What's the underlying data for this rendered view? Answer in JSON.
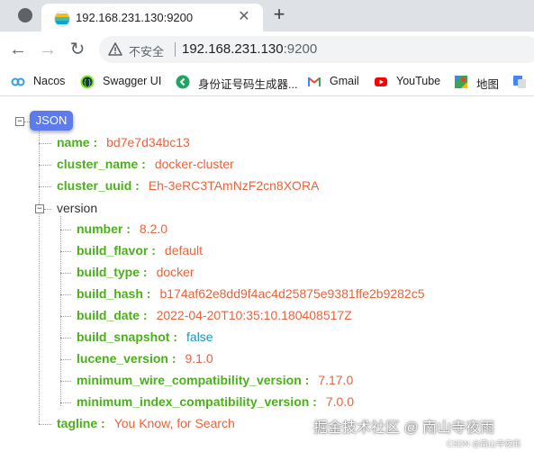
{
  "tab": {
    "title": "192.168.231.130:9200",
    "close": "✕",
    "new_tab": "+"
  },
  "toolbar": {
    "back": "←",
    "forward": "→",
    "reload": "↻",
    "security_label": "不安全",
    "url_host": "192.168.231.130",
    "url_port": ":9200"
  },
  "bookmarks": [
    {
      "label": "Nacos",
      "icon": "nacos-icon"
    },
    {
      "label": "Swagger UI",
      "icon": "swagger-icon"
    },
    {
      "label": "身份证号码生成器...",
      "icon": "id-generator-icon"
    },
    {
      "label": "Gmail",
      "icon": "gmail-icon"
    },
    {
      "label": "YouTube",
      "icon": "youtube-icon"
    },
    {
      "label": "地图",
      "icon": "maps-icon"
    }
  ],
  "json": {
    "root_label": "JSON",
    "toggle_collapse": "−",
    "fields": [
      {
        "key": "name",
        "value": "bd7e7d34bc13"
      },
      {
        "key": "cluster_name",
        "value": "docker-cluster"
      },
      {
        "key": "cluster_uuid",
        "value": "Eh-3eRC3TAmNzF2cn8XORA"
      }
    ],
    "version_key": "version",
    "version_fields": [
      {
        "key": "number",
        "value": "8.2.0",
        "type": "string"
      },
      {
        "key": "build_flavor",
        "value": "default",
        "type": "string"
      },
      {
        "key": "build_type",
        "value": "docker",
        "type": "string"
      },
      {
        "key": "build_hash",
        "value": "b174af62e8dd9f4ac4d25875e9381ffe2b9282c5",
        "type": "string"
      },
      {
        "key": "build_date",
        "value": "2022-04-20T10:35:10.180408517Z",
        "type": "string"
      },
      {
        "key": "build_snapshot",
        "value": "false",
        "type": "boolean"
      },
      {
        "key": "lucene_version",
        "value": "9.1.0",
        "type": "string"
      },
      {
        "key": "minimum_wire_compatibility_version",
        "value": "7.17.0",
        "type": "string"
      },
      {
        "key": "minimum_index_compatibility_version",
        "value": "7.0.0",
        "type": "string"
      }
    ],
    "tagline": {
      "key": "tagline",
      "value": "You Know, for Search"
    }
  },
  "watermark": {
    "main": "掘金技术社区 @ 南山寺夜雨",
    "sub": "CSDN @南山寺夜雨"
  },
  "colors": {
    "key": "#4caf1c",
    "string": "#e8643c",
    "boolean": "#1a98b3",
    "badge": "#5d7bec"
  }
}
